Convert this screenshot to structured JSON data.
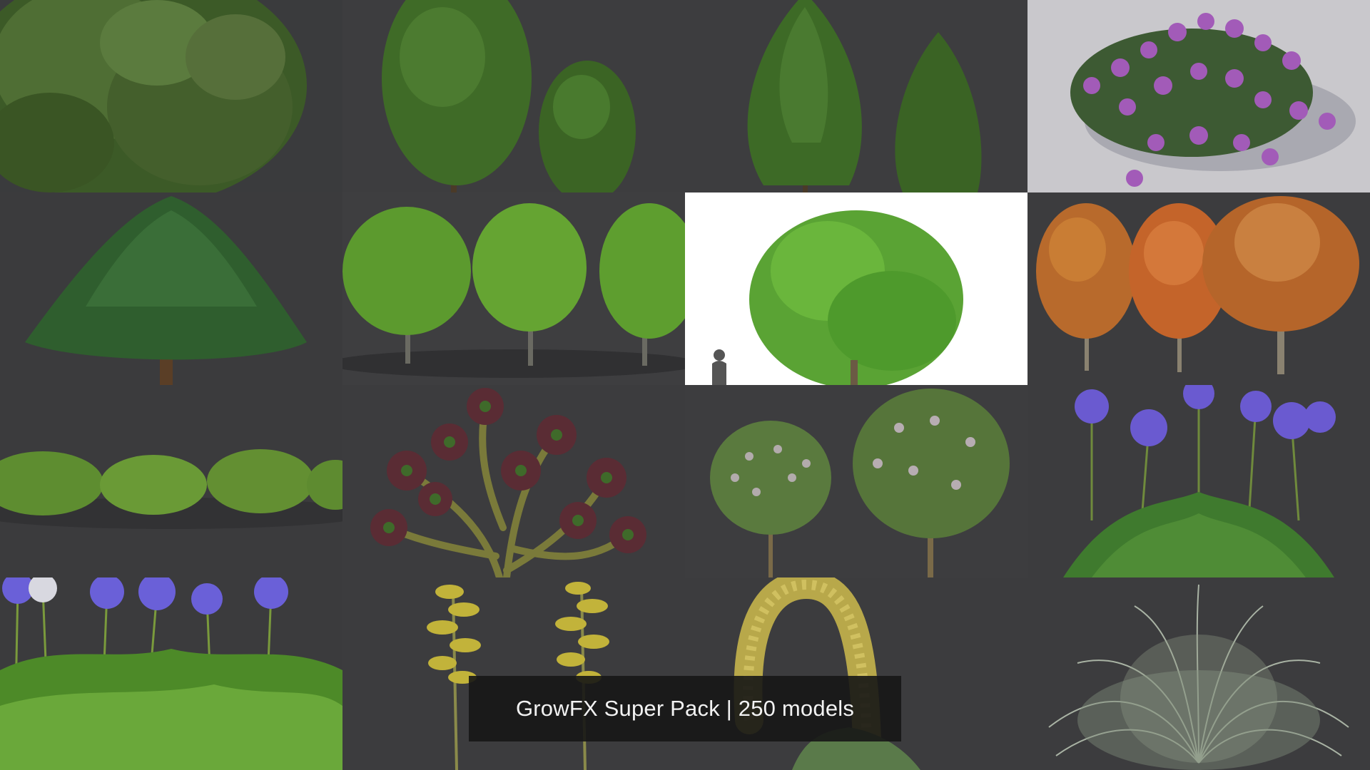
{
  "caption": {
    "text": "GrowFX Super Pack | 250 models"
  },
  "colors": {
    "background": "#3c3c3e",
    "caption_bg": "#161616",
    "caption_text": "#f2f2f2",
    "white_tile": "#ffffff",
    "light_tile": "#c9c8cc"
  },
  "tiles": [
    {
      "subject": "dense-conifer-shrub-icon"
    },
    {
      "subject": "deciduous-tree-pair-icon"
    },
    {
      "subject": "conical-tree-pair-icon"
    },
    {
      "subject": "flowering-succulent-icon"
    },
    {
      "subject": "spreading-canopy-tree-icon"
    },
    {
      "subject": "three-round-trees-icon"
    },
    {
      "subject": "broad-tree-with-silhouette-icon"
    },
    {
      "subject": "autumn-trees-icon"
    },
    {
      "subject": "low-shrub-row-icon"
    },
    {
      "subject": "aeonium-succulent-tree-icon"
    },
    {
      "subject": "flowering-trees-pair-icon"
    },
    {
      "subject": "agapanthus-plant-icon"
    },
    {
      "subject": "agapanthus-border-icon"
    },
    {
      "subject": "agave-flower-stalks-icon"
    },
    {
      "subject": "arched-flower-spike-icon"
    },
    {
      "subject": "ornamental-grass-icon"
    }
  ]
}
